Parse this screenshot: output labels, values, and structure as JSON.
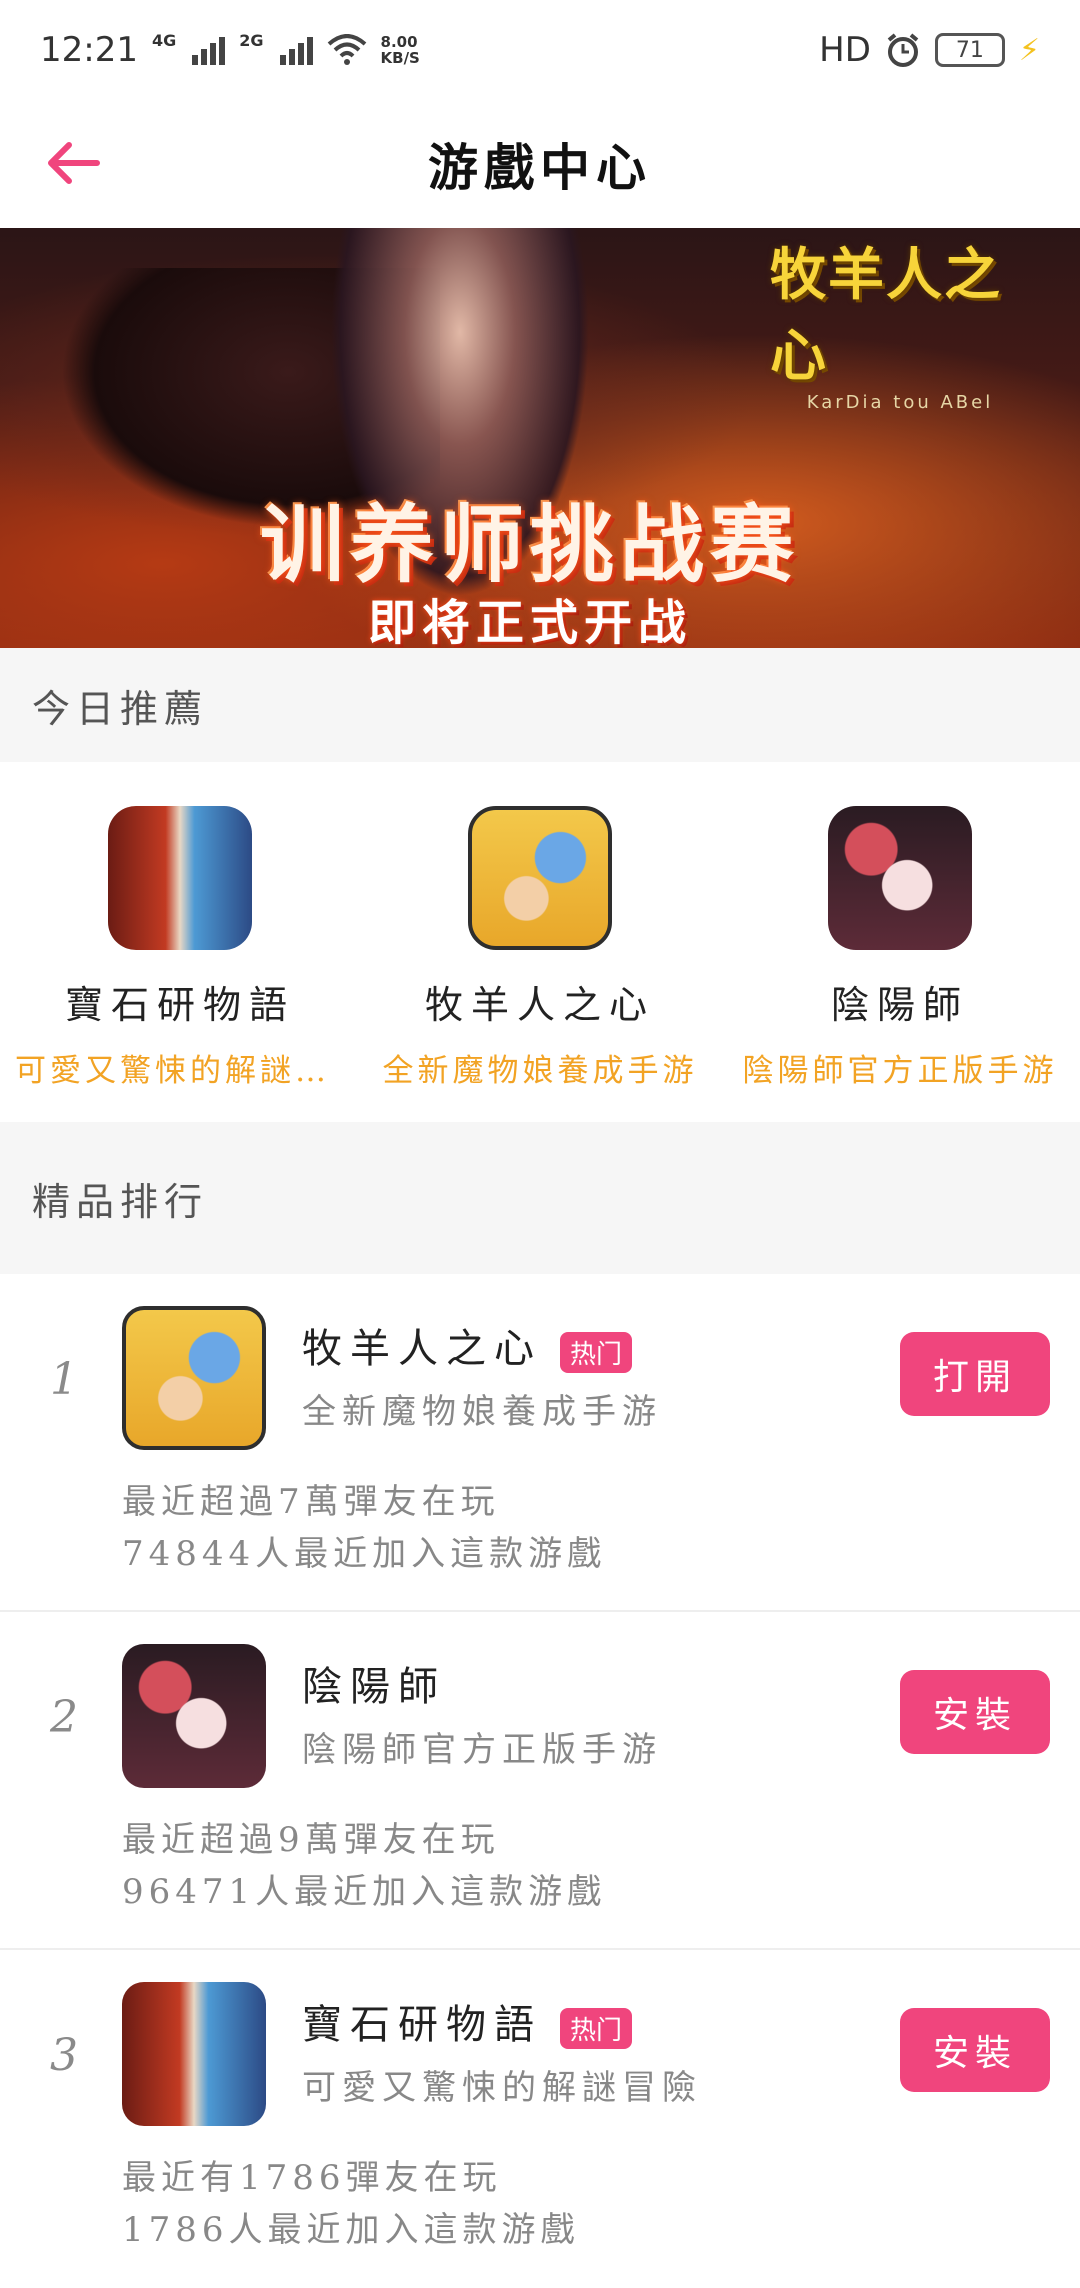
{
  "status_bar": {
    "time": "12:21",
    "net1": "4G",
    "net2": "2G",
    "speed_value": "8.00",
    "speed_unit": "KB/S",
    "hd": "HD",
    "battery": "71"
  },
  "header": {
    "title": "游戲中心"
  },
  "banner": {
    "logo": "牧羊人之心",
    "logo_sub": "KarDia tou ABel",
    "headline": "训养师挑战赛",
    "subline": "即将正式开战"
  },
  "today": {
    "heading": "今日推薦",
    "items": [
      {
        "name": "寶石研物語",
        "desc": "可愛又驚悚的解謎冒險",
        "icon": "gem-story-icon"
      },
      {
        "name": "牧羊人之心",
        "desc": "全新魔物娘養成手游",
        "icon": "shepherd-heart-icon"
      },
      {
        "name": "陰陽師",
        "desc": "陰陽師官方正版手游",
        "icon": "onmyoji-icon"
      }
    ]
  },
  "ranking": {
    "heading": "精品排行",
    "items": [
      {
        "rank": "1",
        "name": "牧羊人之心",
        "badge": "热门",
        "sub": "全新魔物娘養成手游",
        "line1": "最近超過7萬彈友在玩",
        "line2": "74844人最近加入這款游戲",
        "action": "打開",
        "icon": "shepherd-heart-icon"
      },
      {
        "rank": "2",
        "name": "陰陽師",
        "badge": "",
        "sub": "陰陽師官方正版手游",
        "line1": "最近超過9萬彈友在玩",
        "line2": "96471人最近加入這款游戲",
        "action": "安裝",
        "icon": "onmyoji-icon"
      },
      {
        "rank": "3",
        "name": "寶石研物語",
        "badge": "热门",
        "sub": "可愛又驚悚的解謎冒險",
        "line1": "最近有1786彈友在玩",
        "line2": "1786人最近加入這款游戲",
        "action": "安裝",
        "icon": "gem-story-icon"
      }
    ]
  },
  "colors": {
    "accent": "#f0457d",
    "desc_orange": "#f2a324"
  }
}
